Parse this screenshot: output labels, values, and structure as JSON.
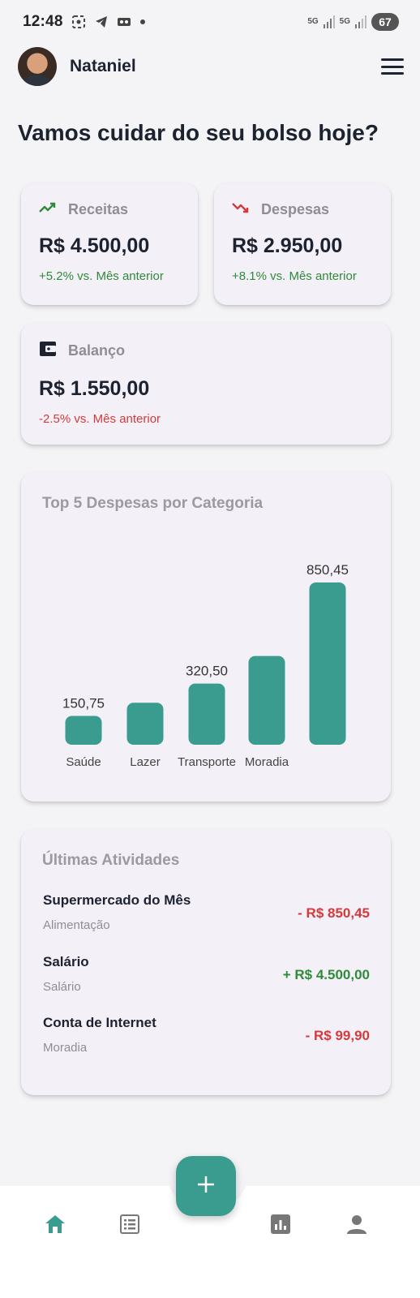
{
  "status_bar": {
    "time": "12:48",
    "network_1": "5G",
    "network_2": "5G",
    "battery": "67"
  },
  "header": {
    "user_name": "Nataniel"
  },
  "greeting": "Vamos cuidar do seu bolso hoje?",
  "summary": {
    "receitas": {
      "label": "Receitas",
      "amount": "R$ 4.500,00",
      "delta": "+5.2% vs. Mês anterior"
    },
    "despesas": {
      "label": "Despesas",
      "amount": "R$ 2.950,00",
      "delta": "+8.1% vs. Mês anterior"
    },
    "balanco": {
      "label": "Balanço",
      "amount": "R$ 1.550,00",
      "delta": "-2.5% vs. Mês anterior"
    }
  },
  "chart_data": {
    "type": "bar",
    "title": "Top 5 Despesas por Categoria",
    "categories": [
      "Saúde",
      "Lazer",
      "Transporte",
      "Moradia",
      ""
    ],
    "values": [
      150.75,
      220,
      320.5,
      465,
      850.45
    ],
    "value_labels": [
      "150,75",
      "",
      "320,50",
      "",
      "850,45"
    ],
    "ylim": [
      0,
      850.45
    ],
    "grid": false,
    "bar_color": "#3a9c8e"
  },
  "activities": {
    "title": "Últimas Atividades",
    "items": [
      {
        "title": "Supermercado do Mês",
        "category": "Alimentação",
        "amount": "- R$ 850,45",
        "kind": "expense"
      },
      {
        "title": "Salário",
        "category": "Salário",
        "amount": "+ R$ 4.500,00",
        "kind": "income"
      },
      {
        "title": "Conta de Internet",
        "category": "Moradia",
        "amount": "- R$ 99,90",
        "kind": "expense"
      }
    ]
  },
  "nav": {
    "items": [
      "home-icon",
      "list-icon",
      "chart-icon",
      "profile-icon"
    ],
    "active": "home-icon",
    "fab_icon": "plus-icon"
  },
  "colors": {
    "accent": "#3a9c8e",
    "positive": "#2f8a39",
    "negative": "#d43a3a",
    "text": "#1c2230",
    "muted": "#8e8e94"
  }
}
